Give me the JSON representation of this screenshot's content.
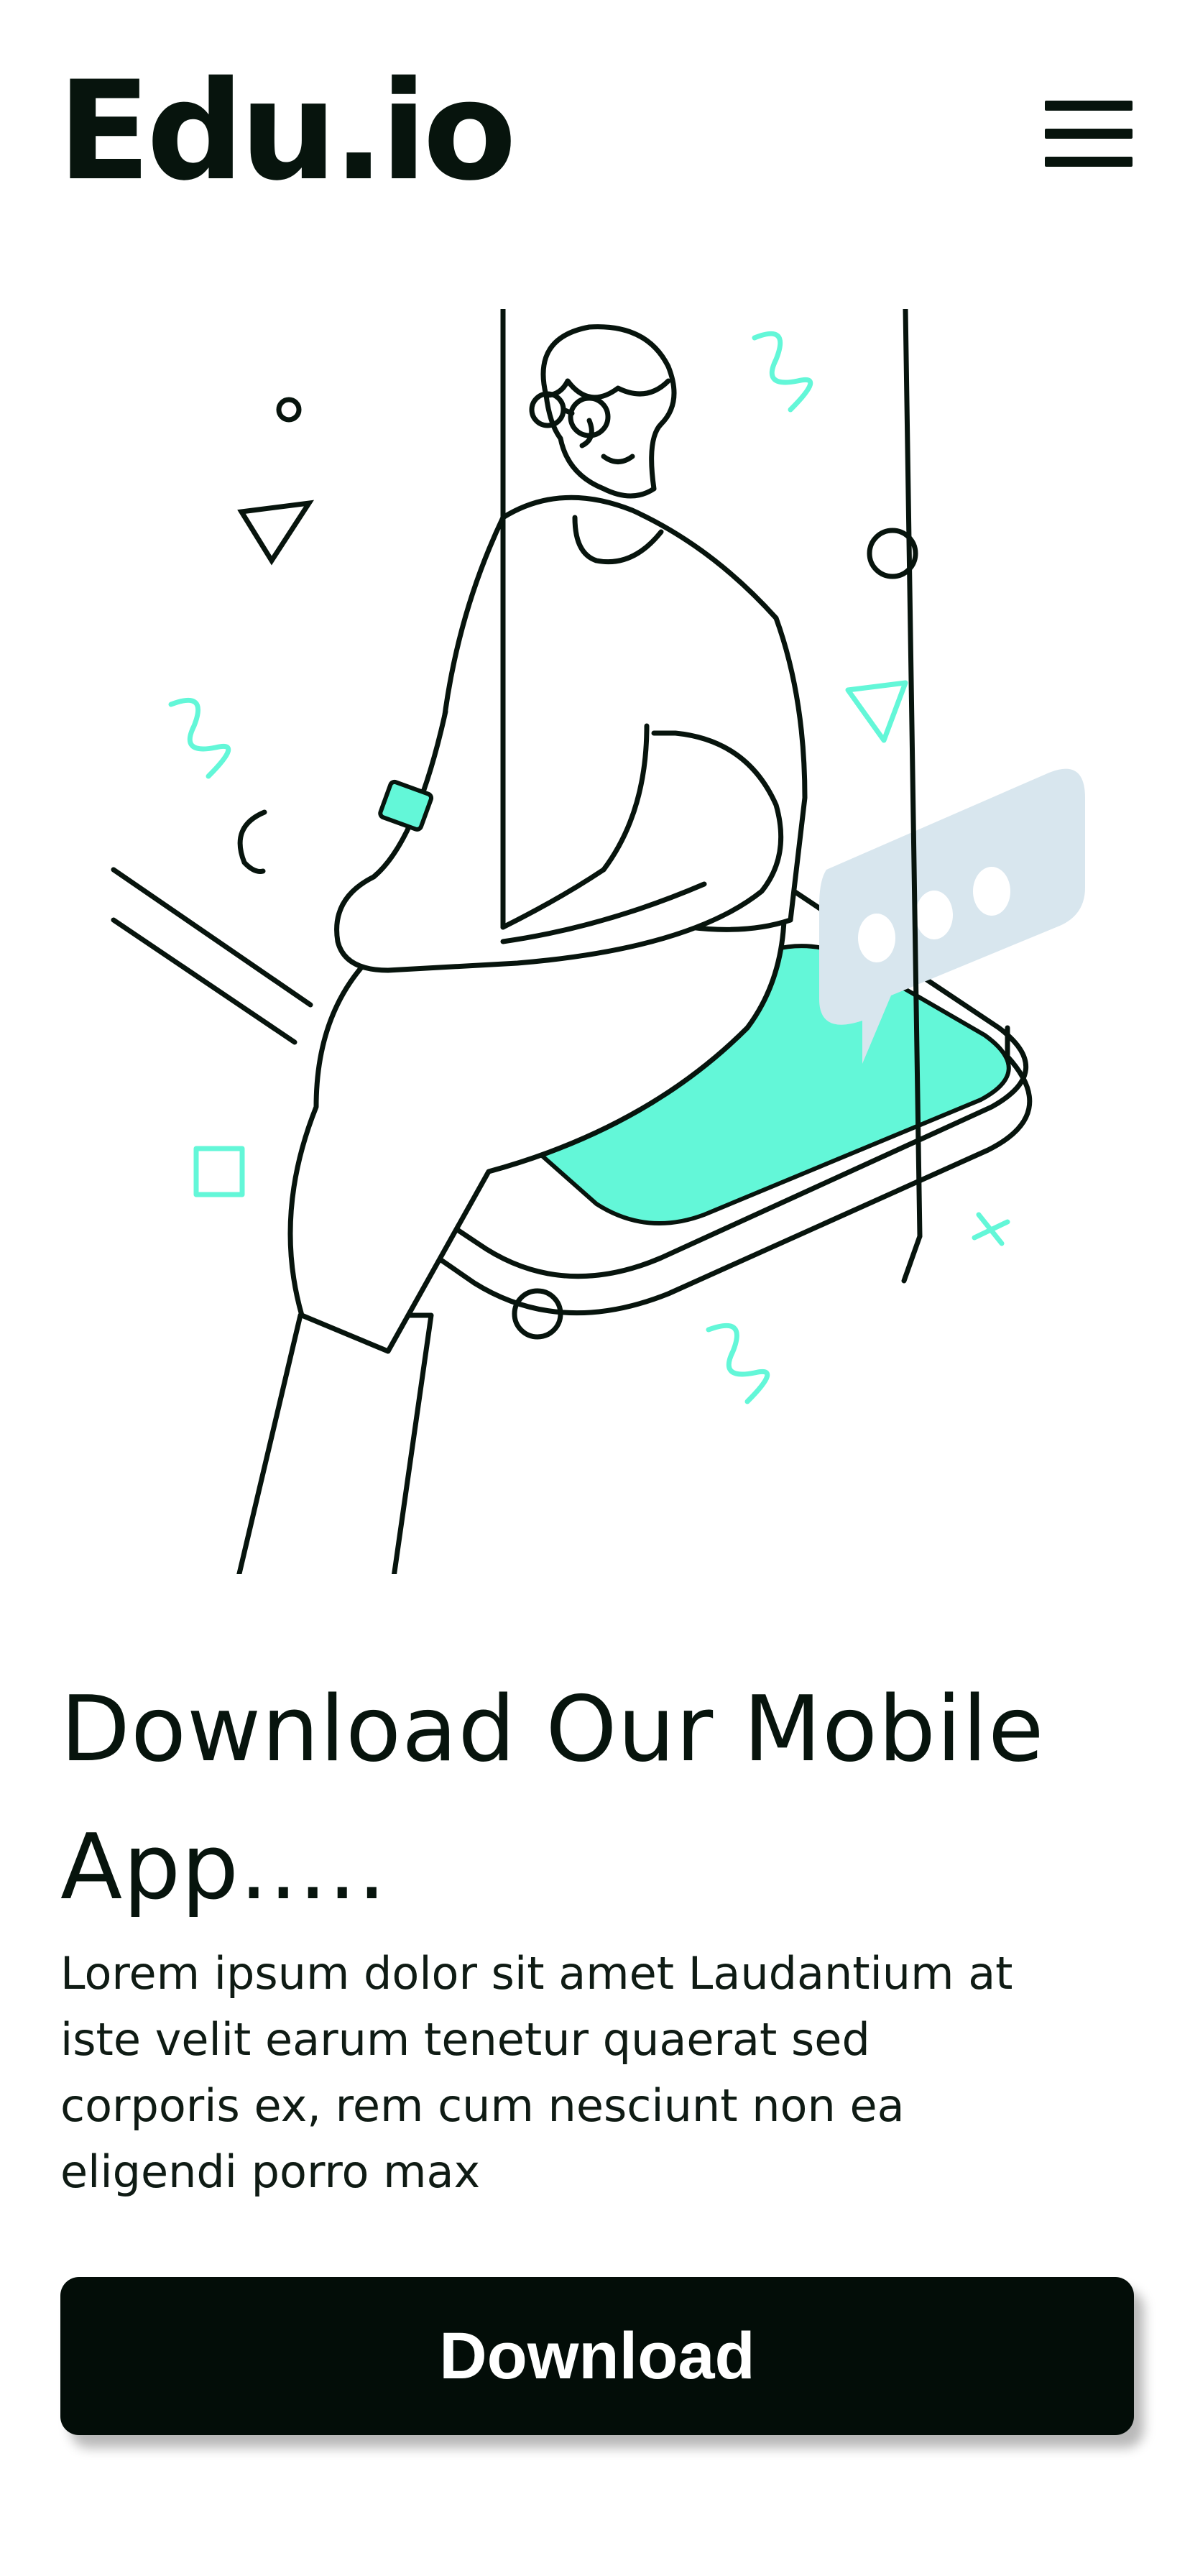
{
  "app": {
    "logo_text": "Edu.io"
  },
  "header": {
    "menu_icon": "hamburger-menu-icon"
  },
  "hero": {
    "illustration": "person-sitting-on-phone-illustration",
    "chat_icon": "chat-bubble-icon"
  },
  "content": {
    "headline": "Download Our Mobile App.....",
    "description": "Lorem ipsum dolor sit amet Laudantium at iste velit earum tenetur quaerat sed corporis ex, rem cum nesciunt non ea eligendi porro max",
    "download_label": "Download"
  },
  "colors": {
    "ink": "#07140d",
    "accent_mint": "#63f7d8",
    "bubble_gray": "#d8e6ee",
    "button_bg": "#030d08",
    "button_text": "#ffffff",
    "shoe": "#253029"
  }
}
